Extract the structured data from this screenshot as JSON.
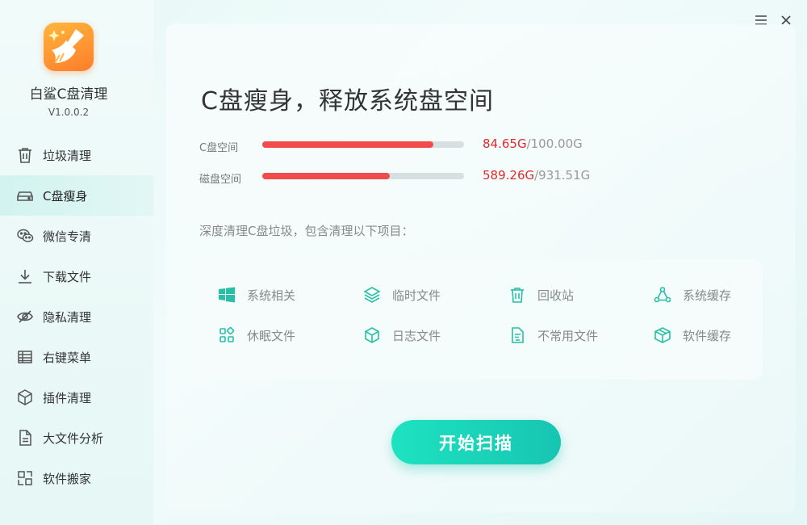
{
  "app": {
    "name": "白鲨C盘清理",
    "version": "V1.0.0.2",
    "logo_icon": "broom-sparkle-icon"
  },
  "colors": {
    "accent": "#1bd3b8",
    "bar_used": "#f24b4b",
    "used_text": "#e02b2b",
    "icon_teal": "#27bfa6"
  },
  "sidebar": {
    "items": [
      {
        "label": "垃圾清理",
        "icon": "trash-icon",
        "active": false
      },
      {
        "label": "C盘瘦身",
        "icon": "disk-drive-icon",
        "active": true
      },
      {
        "label": "微信专清",
        "icon": "wechat-icon",
        "active": false
      },
      {
        "label": "下载文件",
        "icon": "download-icon",
        "active": false
      },
      {
        "label": "隐私清理",
        "icon": "eye-off-icon",
        "active": false
      },
      {
        "label": "右键菜单",
        "icon": "menu-grid-icon",
        "active": false
      },
      {
        "label": "插件清理",
        "icon": "cube-icon",
        "active": false
      },
      {
        "label": "大文件分析",
        "icon": "document-icon",
        "active": false
      },
      {
        "label": "软件搬家",
        "icon": "move-app-icon",
        "active": false
      }
    ]
  },
  "window": {
    "menu_icon": "hamburger-menu-icon",
    "close_icon": "close-icon"
  },
  "main": {
    "title": "C盘瘦身，释放系统盘空间",
    "usage": [
      {
        "label": "C盘空间",
        "used": "84.65G",
        "total": "/100.00G",
        "fraction": 0.8465
      },
      {
        "label": "磁盘空间",
        "used": "589.26G",
        "total": "/931.51G",
        "fraction": 0.6326
      }
    ],
    "intro": "深度清理C盘垃圾，包含清理以下项目：",
    "items": [
      {
        "label": "系统相关",
        "icon": "windows-icon"
      },
      {
        "label": "临时文件",
        "icon": "layers-icon"
      },
      {
        "label": "回收站",
        "icon": "recycle-bin-icon"
      },
      {
        "label": "系统缓存",
        "icon": "network-nodes-icon"
      },
      {
        "label": "休眠文件",
        "icon": "apps-grid-icon"
      },
      {
        "label": "日志文件",
        "icon": "box-icon"
      },
      {
        "label": "不常用文件",
        "icon": "file-edit-icon"
      },
      {
        "label": "软件缓存",
        "icon": "package-icon"
      }
    ],
    "scan_button": "开始扫描"
  }
}
